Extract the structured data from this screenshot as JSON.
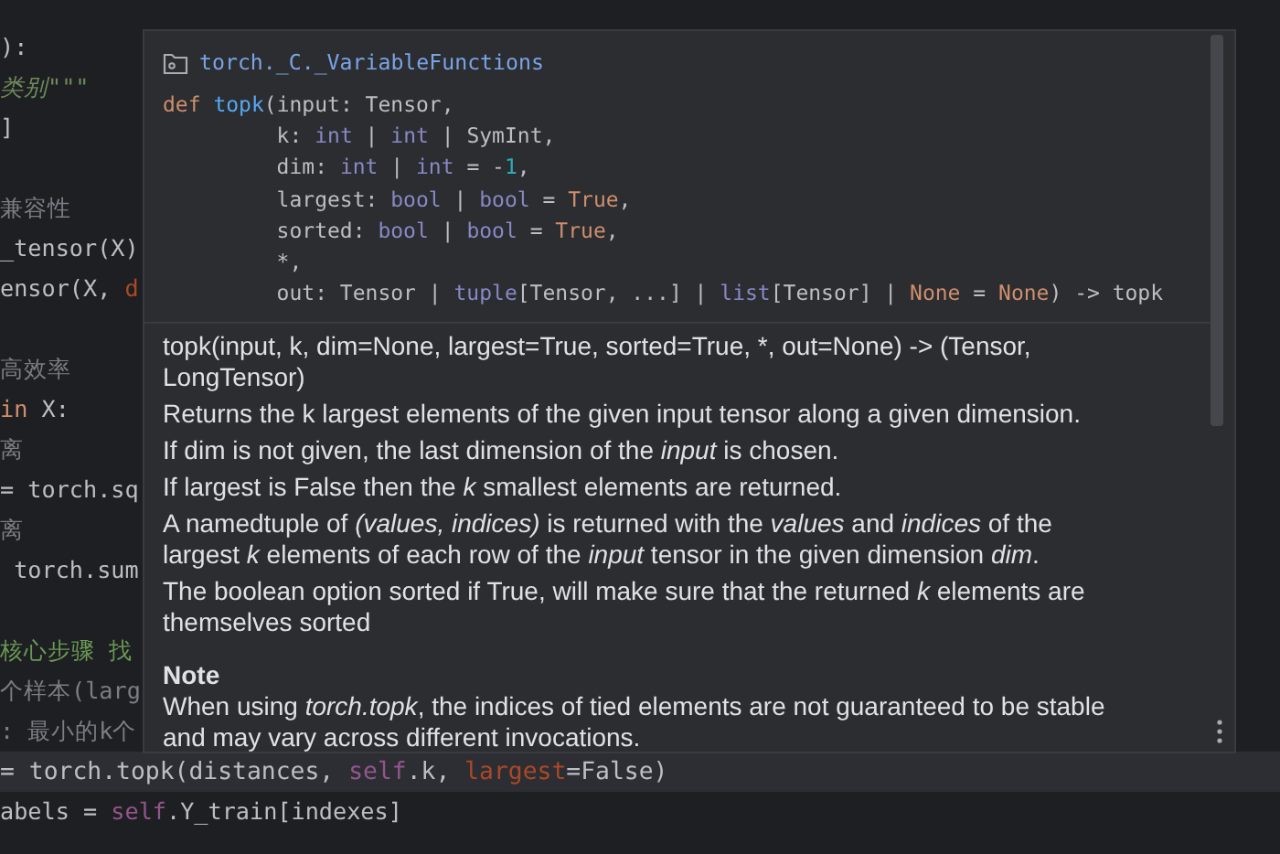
{
  "editor": {
    "lines": [
      {
        "current": false,
        "segments": [
          {
            "text": "):",
            "kind": "plain"
          }
        ]
      },
      {
        "current": false,
        "segments": [
          {
            "text": "类别\"\"\"",
            "kind": "doc"
          }
        ]
      },
      {
        "current": false,
        "segments": [
          {
            "text": "]",
            "kind": "plain"
          }
        ]
      },
      {
        "kind": "blank"
      },
      {
        "current": false,
        "segments": [
          {
            "text": "兼容性",
            "kind": "comment"
          }
        ]
      },
      {
        "current": false,
        "segments": [
          {
            "text": "_tensor(X)",
            "kind": "plain"
          }
        ]
      },
      {
        "current": false,
        "segments": [
          {
            "text": "ensor(X, ",
            "kind": "plain"
          },
          {
            "text": "d",
            "kind": "param"
          }
        ]
      },
      {
        "kind": "blank"
      },
      {
        "current": false,
        "segments": [
          {
            "text": "高效率",
            "kind": "comment"
          }
        ]
      },
      {
        "current": false,
        "segments": [
          {
            "text": "in",
            "kind": "keyword"
          },
          {
            "text": " X:",
            "kind": "plain"
          }
        ]
      },
      {
        "current": false,
        "segments": [
          {
            "text": "离",
            "kind": "comment"
          }
        ]
      },
      {
        "current": false,
        "segments": [
          {
            "text": "= torch.sq",
            "kind": "plain"
          }
        ]
      },
      {
        "current": false,
        "segments": [
          {
            "text": "离",
            "kind": "comment"
          }
        ]
      },
      {
        "current": false,
        "segments": [
          {
            "text": " torch.sum",
            "kind": "plain"
          }
        ]
      },
      {
        "kind": "blank"
      },
      {
        "current": false,
        "segments": [
          {
            "text": "核心步骤 找",
            "kind": "todo"
          }
        ]
      },
      {
        "current": false,
        "segments": [
          {
            "text": "个样本(larg",
            "kind": "comment"
          }
        ]
      },
      {
        "current": false,
        "segments": [
          {
            "text": ": 最小的k个",
            "kind": "comment"
          }
        ]
      },
      {
        "current": true,
        "segments": [
          {
            "text": "= torch.topk(distances, ",
            "kind": "plain"
          },
          {
            "text": "self",
            "kind": "self"
          },
          {
            "text": ".k, ",
            "kind": "plain"
          },
          {
            "text": "largest",
            "kind": "param"
          },
          {
            "text": "=False)",
            "kind": "plain"
          }
        ]
      },
      {
        "current": false,
        "segments": [
          {
            "text": "abels = ",
            "kind": "plain"
          },
          {
            "text": "self",
            "kind": "self"
          },
          {
            "text": ".Y_train[indexes]",
            "kind": "plain"
          }
        ]
      }
    ]
  },
  "popup": {
    "module": "torch._C._VariableFunctions",
    "signature": [
      [
        {
          "text": "def ",
          "kind": "keyword"
        },
        {
          "text": "topk",
          "kind": "fn"
        },
        {
          "text": "(input: Tensor,",
          "kind": "plain"
        }
      ],
      [
        {
          "text": "         k: ",
          "kind": "plain"
        },
        {
          "text": "int",
          "kind": "type"
        },
        {
          "text": " | ",
          "kind": "plain"
        },
        {
          "text": "int",
          "kind": "type"
        },
        {
          "text": " | SymInt,",
          "kind": "plain"
        }
      ],
      [
        {
          "text": "         dim: ",
          "kind": "plain"
        },
        {
          "text": "int",
          "kind": "type"
        },
        {
          "text": " | ",
          "kind": "plain"
        },
        {
          "text": "int",
          "kind": "type"
        },
        {
          "text": " = -",
          "kind": "plain"
        },
        {
          "text": "1",
          "kind": "num"
        },
        {
          "text": ",",
          "kind": "plain"
        }
      ],
      [
        {
          "text": "         largest: ",
          "kind": "plain"
        },
        {
          "text": "bool",
          "kind": "type"
        },
        {
          "text": " | ",
          "kind": "plain"
        },
        {
          "text": "bool",
          "kind": "type"
        },
        {
          "text": " = ",
          "kind": "plain"
        },
        {
          "text": "True",
          "kind": "keyword"
        },
        {
          "text": ",",
          "kind": "plain"
        }
      ],
      [
        {
          "text": "         sorted: ",
          "kind": "plain"
        },
        {
          "text": "bool",
          "kind": "type"
        },
        {
          "text": " | ",
          "kind": "plain"
        },
        {
          "text": "bool",
          "kind": "type"
        },
        {
          "text": " = ",
          "kind": "plain"
        },
        {
          "text": "True",
          "kind": "keyword"
        },
        {
          "text": ",",
          "kind": "plain"
        }
      ],
      [
        {
          "text": "         *,",
          "kind": "plain"
        }
      ],
      [
        {
          "text": "         out: Tensor | ",
          "kind": "plain"
        },
        {
          "text": "tuple",
          "kind": "type"
        },
        {
          "text": "[Tensor, ...] | ",
          "kind": "plain"
        },
        {
          "text": "list",
          "kind": "type"
        },
        {
          "text": "[Tensor] | ",
          "kind": "plain"
        },
        {
          "text": "None",
          "kind": "keyword"
        },
        {
          "text": " = ",
          "kind": "plain"
        },
        {
          "text": "None",
          "kind": "keyword"
        },
        {
          "text": ") -> topk",
          "kind": "plain"
        }
      ]
    ],
    "docs": [
      "topk(input, k, dim=None, largest=True, sorted=True, *, out=None) -> (Tensor, LongTensor)",
      "Returns the k largest elements of the given input tensor along a given dimension.",
      "If dim is not given, the last dimension of the *input* is chosen.",
      "If largest is False then the *k* smallest elements are returned.",
      "A namedtuple of *(values, indices)* is returned with the *values* and *indices* of the largest *k* elements of each row of the *input* tensor in the given dimension *dim*.",
      "The boolean option sorted if True, will make sure that the returned *k* elements are themselves sorted"
    ],
    "note": {
      "title": "Note",
      "text": "When using *torch.topk*, the indices of tied elements are not guaranteed to be stable and may vary across different invocations."
    }
  }
}
